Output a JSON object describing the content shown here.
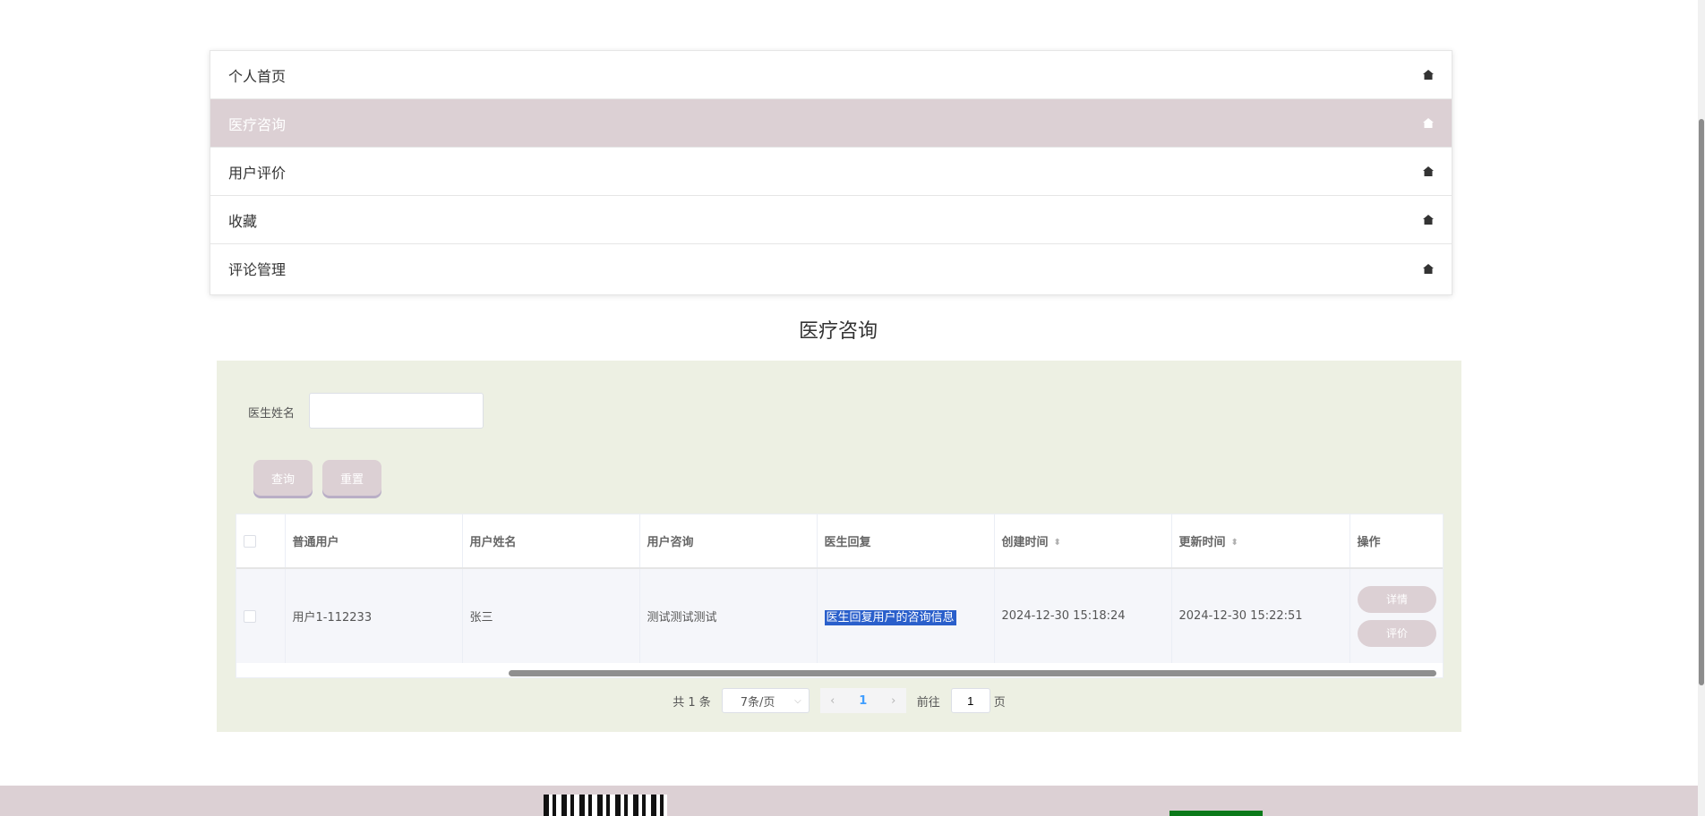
{
  "menu": {
    "items": [
      {
        "label": "个人首页",
        "active": false
      },
      {
        "label": "医疗咨询",
        "active": true
      },
      {
        "label": "用户评价",
        "active": false
      },
      {
        "label": "收藏",
        "active": false
      },
      {
        "label": "评论管理",
        "active": false
      }
    ],
    "icon": "home-icon"
  },
  "page": {
    "title": "医疗咨询"
  },
  "search": {
    "label": "医生姓名",
    "value": "",
    "placeholder": "",
    "query_button": "查询",
    "reset_button": "重置"
  },
  "table": {
    "headers": [
      "普通用户",
      "用户姓名",
      "用户咨询",
      "医生回复",
      "创建时间",
      "更新时间",
      "操作"
    ],
    "rows": [
      {
        "user": "用户1-112233",
        "name": "张三",
        "consult": "测试测试测试",
        "reply": "医生回复用户的咨询信息",
        "created": "2024-12-30 15:18:24",
        "updated": "2024-12-30 15:22:51",
        "actions": [
          "详情",
          "评价"
        ]
      }
    ]
  },
  "pagination": {
    "total_text": "共 1 条",
    "page_size": "7条/页",
    "current_page": "1",
    "goto_label": "前往",
    "goto_value": "1",
    "page_suffix": "页"
  },
  "colors": {
    "accent": "#dcd0d4",
    "panel_bg": "#edf0e3",
    "selection": "#2a5fcb"
  }
}
